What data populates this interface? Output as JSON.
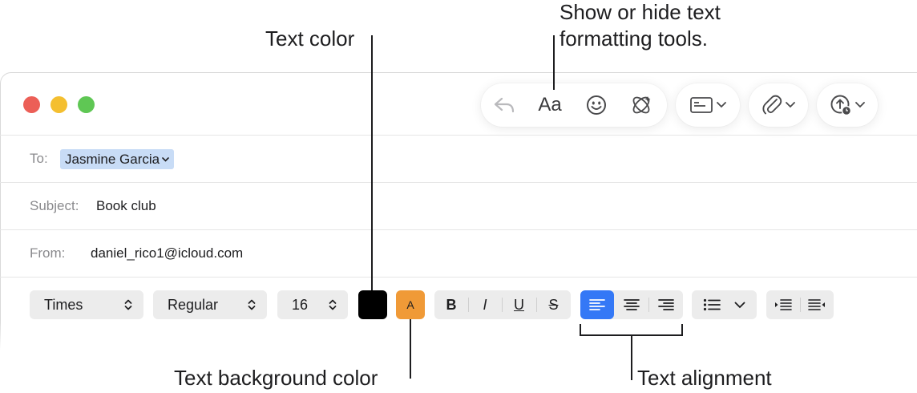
{
  "callouts": {
    "text_color": "Text color",
    "show_hide_line1": "Show or hide text",
    "show_hide_line2": "formatting tools.",
    "text_background_color": "Text background color",
    "text_alignment": "Text alignment"
  },
  "toolbar": {
    "format_label": "Aa",
    "icons": [
      "reply-icon",
      "emoji-icon",
      "writing-tools-icon",
      "header-fields-icon",
      "attachment-icon",
      "send-later-icon"
    ]
  },
  "header": {
    "to_label": "To:",
    "to_value": "Jasmine Garcia",
    "subject_label": "Subject:",
    "subject_value": "Book club",
    "from_label": "From:",
    "from_value": "daniel_rico1@icloud.com"
  },
  "format_bar": {
    "font": "Times",
    "style": "Regular",
    "size": "16",
    "text_color": "#000000",
    "background_color": "#f09a37",
    "background_swatch_label": "A",
    "bold": "B",
    "italic": "I",
    "underline": "U",
    "strike": "S",
    "alignment_selected": "left"
  },
  "colors": {
    "accent": "#3478f6",
    "recipient_highlight": "#c8dcf6",
    "close": "#ec5f57",
    "minimize": "#f4bf30",
    "maximize": "#5fc754"
  }
}
